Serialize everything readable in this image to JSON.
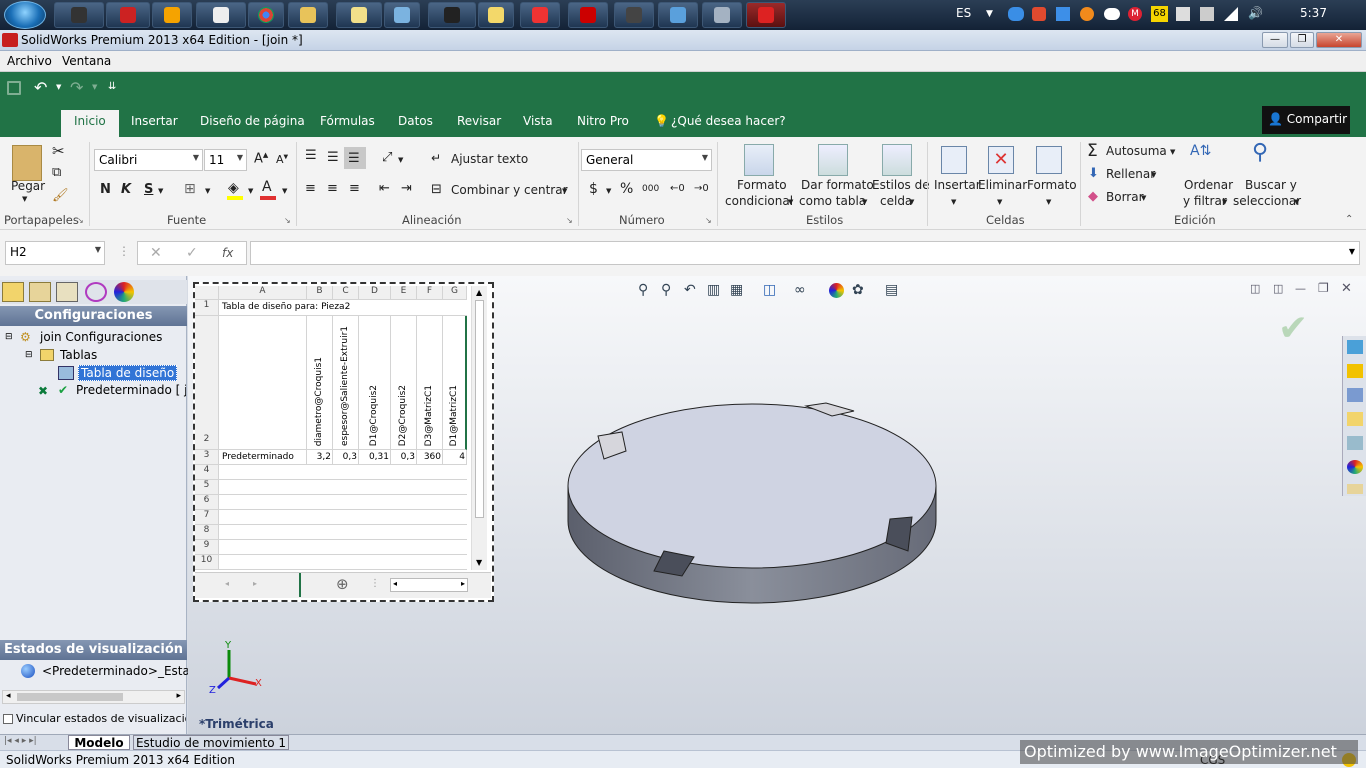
{
  "system": {
    "language": "ES",
    "clock": "5:37",
    "tray_badge": "68"
  },
  "window": {
    "title": "SolidWorks Premium 2013 x64 Edition - [join *]"
  },
  "menu": {
    "archivo": "Archivo",
    "ventana": "Ventana"
  },
  "ribbon": {
    "tabs": [
      "Inicio",
      "Insertar",
      "Diseño de página",
      "Fórmulas",
      "Datos",
      "Revisar",
      "Vista",
      "Nitro Pro",
      "¿Qué desea hacer?"
    ],
    "share": "Compartir",
    "clipboard": {
      "paste": "Pegar",
      "group": "Portapapeles"
    },
    "font": {
      "name": "Calibri",
      "size": "11",
      "bold": "N",
      "italic": "K",
      "underline": "S",
      "color_letter": "A",
      "group": "Fuente"
    },
    "alignment": {
      "wrap": "Ajustar texto",
      "merge": "Combinar y centrar",
      "group": "Alineación"
    },
    "number": {
      "format": "General",
      "currency": "$",
      "percent": "%",
      "thousands": "000",
      "group": "Número"
    },
    "styles": {
      "conditional": [
        "Formato",
        "condicional"
      ],
      "table": [
        "Dar formato",
        "como tabla"
      ],
      "cell": [
        "Estilos de",
        "celda"
      ],
      "group": "Estilos"
    },
    "cells": {
      "insert": "Insertar",
      "delete": "Eliminar",
      "format": "Formato",
      "group": "Celdas"
    },
    "editing": {
      "autosum": "Autosuma",
      "fill": "Rellenar",
      "clear": "Borrar",
      "sort": [
        "Ordenar",
        "y filtrar"
      ],
      "find": [
        "Buscar y",
        "seleccionar"
      ],
      "group": "Edición"
    }
  },
  "formula_bar": {
    "name_box": "H2",
    "fx": "fx",
    "value": ""
  },
  "config_panel": {
    "header": "Configuraciones",
    "tree": {
      "root": "join Configuraciones",
      "tables": "Tablas",
      "design_table": "Tabla de diseño",
      "default": "Predeterminado [ join ]"
    },
    "display_states_header": "Estados de visualización",
    "display_state": "<Predeterminado>_Estado",
    "link_checkbox": "Vincular estados de visualización a c"
  },
  "design_table": {
    "columns": [
      "A",
      "B",
      "C",
      "D",
      "E",
      "F",
      "G"
    ],
    "title_cell": "Tabla de diseño para: Pieza2",
    "params": [
      "diametro@Croquis1",
      "espesor@Saliente-Extruir1",
      "D1@Croquis2",
      "D2@Croquis2",
      "D3@MatrizC1",
      "D1@MatrizC1"
    ],
    "config_name": "Predeterminado",
    "values": [
      "3,2",
      "0,3",
      "0,31",
      "0,3",
      "360",
      "4"
    ],
    "rows": [
      "1",
      "2",
      "3",
      "4",
      "5",
      "6",
      "7",
      "8",
      "9",
      "10"
    ]
  },
  "viewport": {
    "view_label": "*Trimétrica",
    "axis_x": "X",
    "axis_y": "Y",
    "axis_z": "Z"
  },
  "bottom_tabs": [
    "Modelo",
    "Estudio de movimiento 1"
  ],
  "status": {
    "text": "SolidWorks Premium 2013 x64 Edition",
    "units": "CGS",
    "watermark": "Optimized by www.ImageOptimizer.net"
  },
  "colors": {
    "excel_green": "#217346",
    "sw_panel_header": "#5f7394"
  }
}
